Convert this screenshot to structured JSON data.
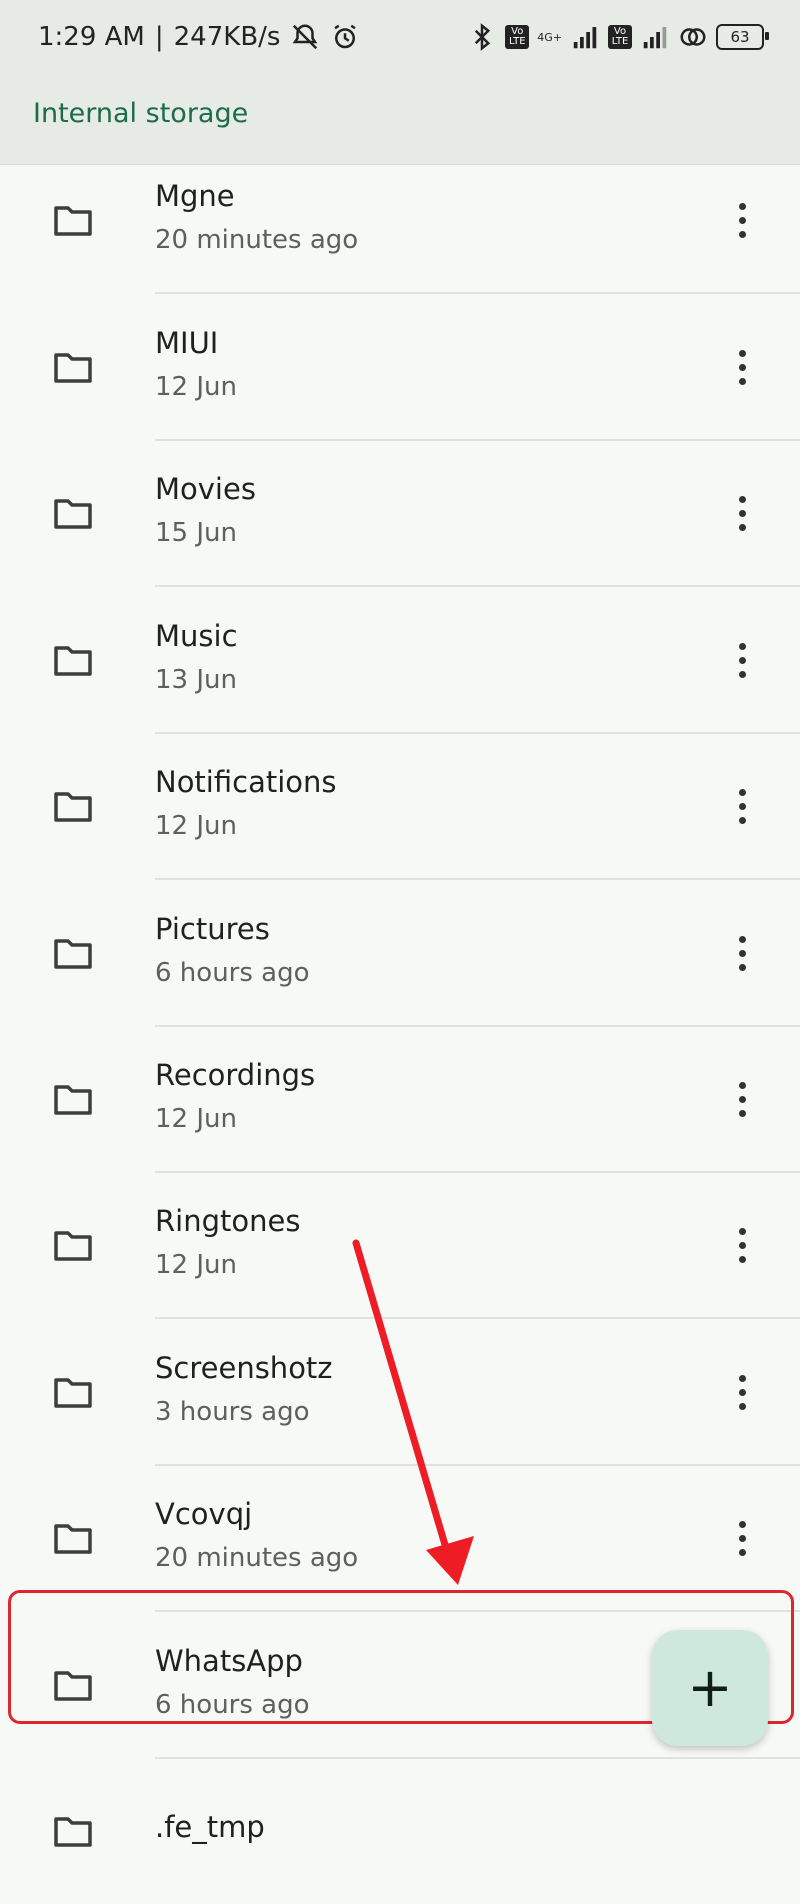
{
  "status_bar": {
    "time": "1:29 AM",
    "speed": "247KB/s",
    "network": "4G+",
    "tags": [
      "Vo LTE",
      "Vo LTE"
    ],
    "battery": "63"
  },
  "header": {
    "title": "Internal storage"
  },
  "colors": {
    "accent": "#1c6b4b",
    "highlight": "#e0262d",
    "fab_bg": "#cfe8dd"
  },
  "folders": [
    {
      "name": "Mgne",
      "date": "20 minutes ago"
    },
    {
      "name": "MIUI",
      "date": "12 Jun"
    },
    {
      "name": "Movies",
      "date": "15 Jun"
    },
    {
      "name": "Music",
      "date": "13 Jun"
    },
    {
      "name": "Notifications",
      "date": "12 Jun"
    },
    {
      "name": "Pictures",
      "date": "6 hours ago"
    },
    {
      "name": "Recordings",
      "date": "12 Jun"
    },
    {
      "name": "Ringtones",
      "date": "12 Jun"
    },
    {
      "name": "Screenshotz",
      "date": "3 hours ago"
    },
    {
      "name": "Vcovqj",
      "date": "20 minutes ago"
    },
    {
      "name": "WhatsApp",
      "date": "6 hours ago"
    },
    {
      "name": ".fe_tmp",
      "date": ""
    }
  ],
  "fab": {
    "label": "+"
  },
  "icons": {
    "folder": "folder-icon",
    "more": "more-vert-icon",
    "add": "add-icon"
  }
}
